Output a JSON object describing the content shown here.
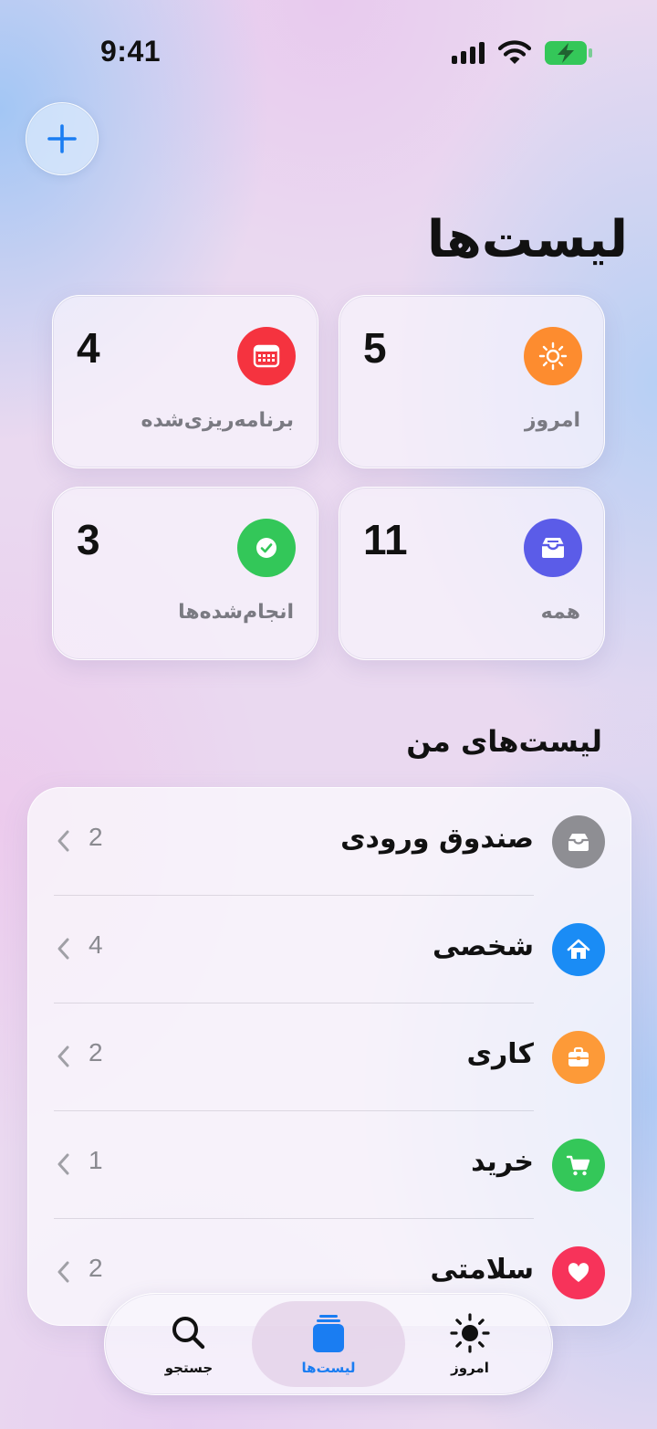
{
  "status_bar": {
    "time": "9:41"
  },
  "header": {
    "title": "لیست‌ها",
    "add_icon": "plus-icon"
  },
  "summary_cards": [
    {
      "id": "today",
      "label": "امروز",
      "count": "5",
      "icon": "sun-icon",
      "color": "#fd8c2f"
    },
    {
      "id": "scheduled",
      "label": "برنامه‌ریزی‌شده",
      "count": "4",
      "icon": "calendar-icon",
      "color": "#f5333f"
    },
    {
      "id": "all",
      "label": "همه",
      "count": "11",
      "icon": "tray-icon",
      "color": "#5b5ce8"
    },
    {
      "id": "completed",
      "label": "انجام‌شده‌ها",
      "count": "3",
      "icon": "checkmark-icon",
      "color": "#33c759"
    }
  ],
  "my_lists": {
    "title": "لیست‌های من",
    "items": [
      {
        "label": "صندوق ورودی",
        "count": "2",
        "icon": "tray-icon",
        "color": "#8e8e93"
      },
      {
        "label": "شخصی",
        "count": "4",
        "icon": "house-icon",
        "color": "#1a8cf5"
      },
      {
        "label": "کاری",
        "count": "2",
        "icon": "briefcase-icon",
        "color": "#fd9a38"
      },
      {
        "label": "خرید",
        "count": "1",
        "icon": "cart-icon",
        "color": "#34c759"
      },
      {
        "label": "سلامتی",
        "count": "2",
        "icon": "heart-icon",
        "color": "#f7335a"
      }
    ]
  },
  "tab_bar": {
    "tabs": [
      {
        "label": "امروز",
        "icon": "sun-icon",
        "active": false
      },
      {
        "label": "لیست‌ها",
        "icon": "lists-icon",
        "active": true
      },
      {
        "label": "جستجو",
        "icon": "search-icon",
        "active": false
      }
    ]
  }
}
